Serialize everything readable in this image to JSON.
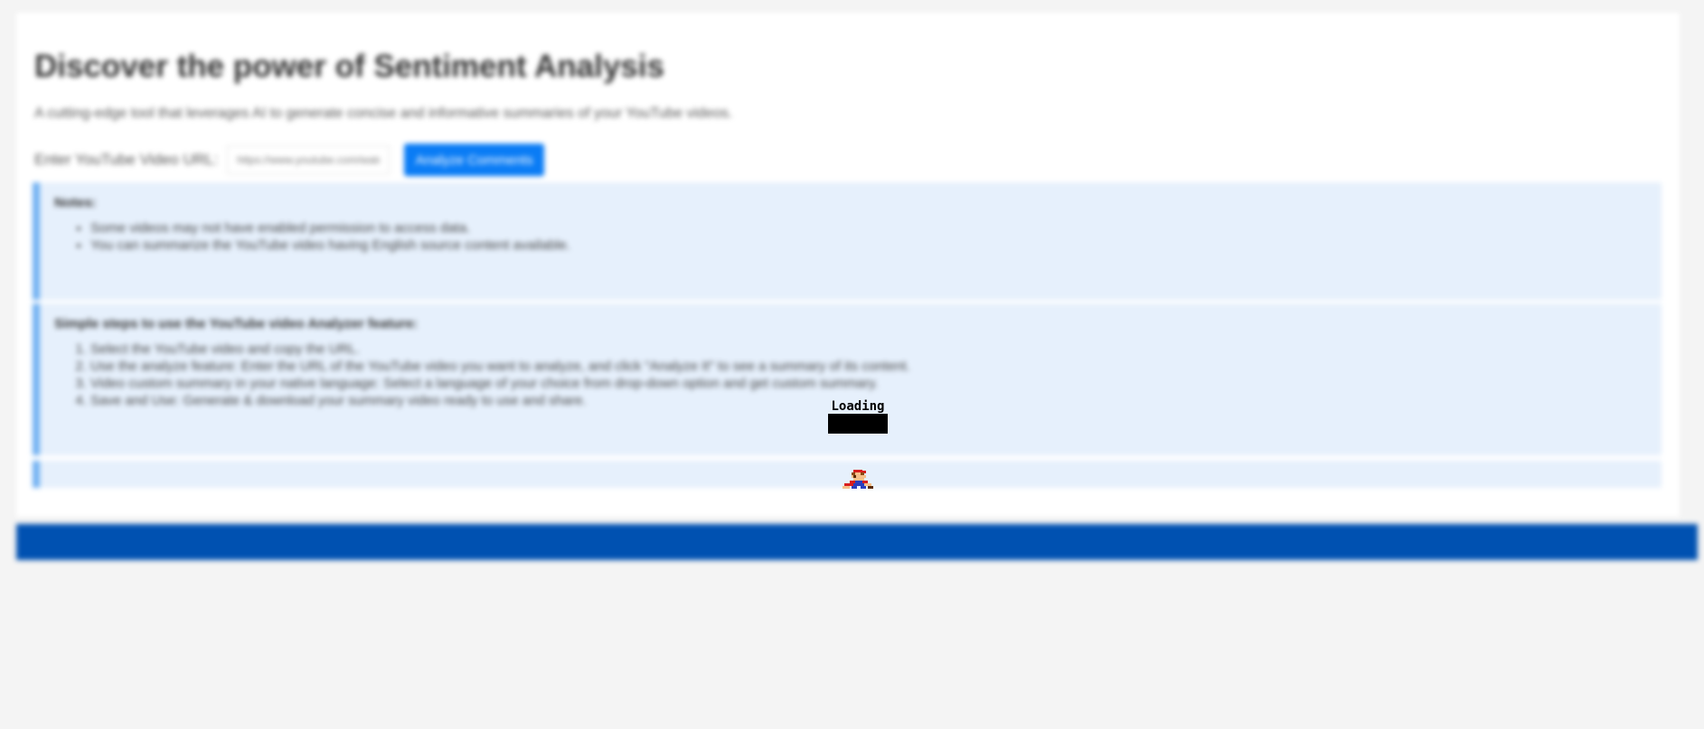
{
  "header": {
    "title": "Discover the power of Sentiment Analysis",
    "subtitle": "A cutting-edge tool that leverages AI to generate concise and informative summaries of your YouTube videos."
  },
  "url_form": {
    "label": "Enter YouTube Video URL:",
    "placeholder": "https://www.youtube.com/watch",
    "button_label": "Analyze Comments"
  },
  "notes": {
    "heading": "Notes:",
    "items": [
      "Some videos may not have enabled permission to access data.",
      "You can summarize the YouTube video having English source content available."
    ]
  },
  "steps": {
    "heading": "Simple steps to use the YouTube video Analyzer feature:",
    "items": [
      "Select the YouTube video and copy the URL.",
      "Use the analyze feature: Enter the URL of the YouTube video you want to analyze, and click \"Analyze It\" to see a summary of its content.",
      "Video custom summary in your native language: Select a language of your choice from drop-down option and get custom summary.",
      "Save and Use: Generate & download your summary video ready to use and share."
    ]
  },
  "loading": {
    "text": "Loading"
  },
  "icons": {
    "loader_sprite": "mario-sprite-icon"
  },
  "colors": {
    "accent_button": "#0a7cf5",
    "footer_bar": "#0051b1",
    "info_background": "#e6f0fc",
    "info_border": "#6fb0f2"
  }
}
